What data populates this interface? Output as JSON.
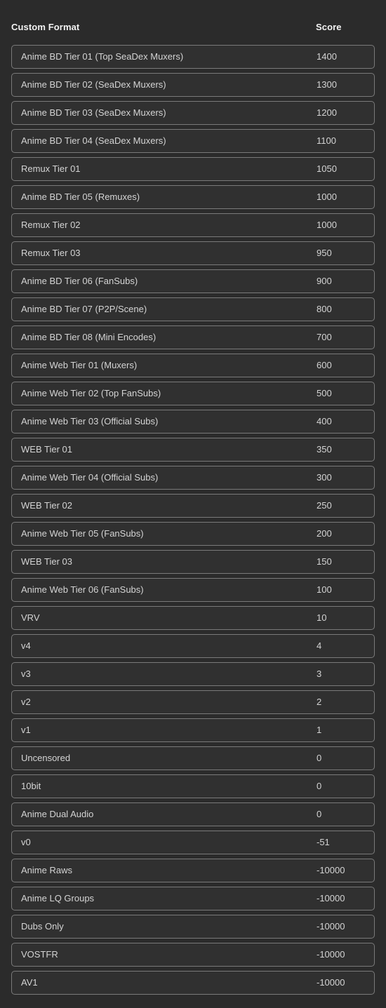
{
  "table": {
    "columns": {
      "format_header": "Custom Format",
      "score_header": "Score"
    },
    "rows": [
      {
        "format": "Anime BD Tier 01 (Top SeaDex Muxers)",
        "score": "1400"
      },
      {
        "format": "Anime BD Tier 02 (SeaDex Muxers)",
        "score": "1300"
      },
      {
        "format": "Anime BD Tier 03 (SeaDex Muxers)",
        "score": "1200"
      },
      {
        "format": "Anime BD Tier 04 (SeaDex Muxers)",
        "score": "1100"
      },
      {
        "format": "Remux Tier 01",
        "score": "1050"
      },
      {
        "format": "Anime BD Tier 05 (Remuxes)",
        "score": "1000"
      },
      {
        "format": "Remux Tier 02",
        "score": "1000"
      },
      {
        "format": "Remux Tier 03",
        "score": "950"
      },
      {
        "format": "Anime BD Tier 06 (FanSubs)",
        "score": "900"
      },
      {
        "format": "Anime BD Tier 07 (P2P/Scene)",
        "score": "800"
      },
      {
        "format": "Anime BD Tier 08 (Mini Encodes)",
        "score": "700"
      },
      {
        "format": "Anime Web Tier 01 (Muxers)",
        "score": "600"
      },
      {
        "format": "Anime Web Tier 02 (Top FanSubs)",
        "score": "500"
      },
      {
        "format": "Anime Web Tier 03 (Official Subs)",
        "score": "400"
      },
      {
        "format": "WEB Tier 01",
        "score": "350"
      },
      {
        "format": "Anime Web Tier 04 (Official Subs)",
        "score": "300"
      },
      {
        "format": "WEB Tier 02",
        "score": "250"
      },
      {
        "format": "Anime Web Tier 05 (FanSubs)",
        "score": "200"
      },
      {
        "format": "WEB Tier 03",
        "score": "150"
      },
      {
        "format": "Anime Web Tier 06 (FanSubs)",
        "score": "100"
      },
      {
        "format": "VRV",
        "score": "10"
      },
      {
        "format": "v4",
        "score": "4"
      },
      {
        "format": "v3",
        "score": "3"
      },
      {
        "format": "v2",
        "score": "2"
      },
      {
        "format": "v1",
        "score": "1"
      },
      {
        "format": "Uncensored",
        "score": "0"
      },
      {
        "format": "10bit",
        "score": "0"
      },
      {
        "format": "Anime Dual Audio",
        "score": "0"
      },
      {
        "format": "v0",
        "score": "-51"
      },
      {
        "format": "Anime Raws",
        "score": "-10000"
      },
      {
        "format": "Anime LQ Groups",
        "score": "-10000"
      },
      {
        "format": "Dubs Only",
        "score": "-10000"
      },
      {
        "format": "VOSTFR",
        "score": "-10000"
      },
      {
        "format": "AV1",
        "score": "-10000"
      }
    ]
  },
  "theme": {
    "background": "#2b2b2b",
    "row_background": "#303030",
    "row_border": "#7a7a7a",
    "header_text": "#f2f2f2",
    "row_text": "#d4d4d4"
  }
}
